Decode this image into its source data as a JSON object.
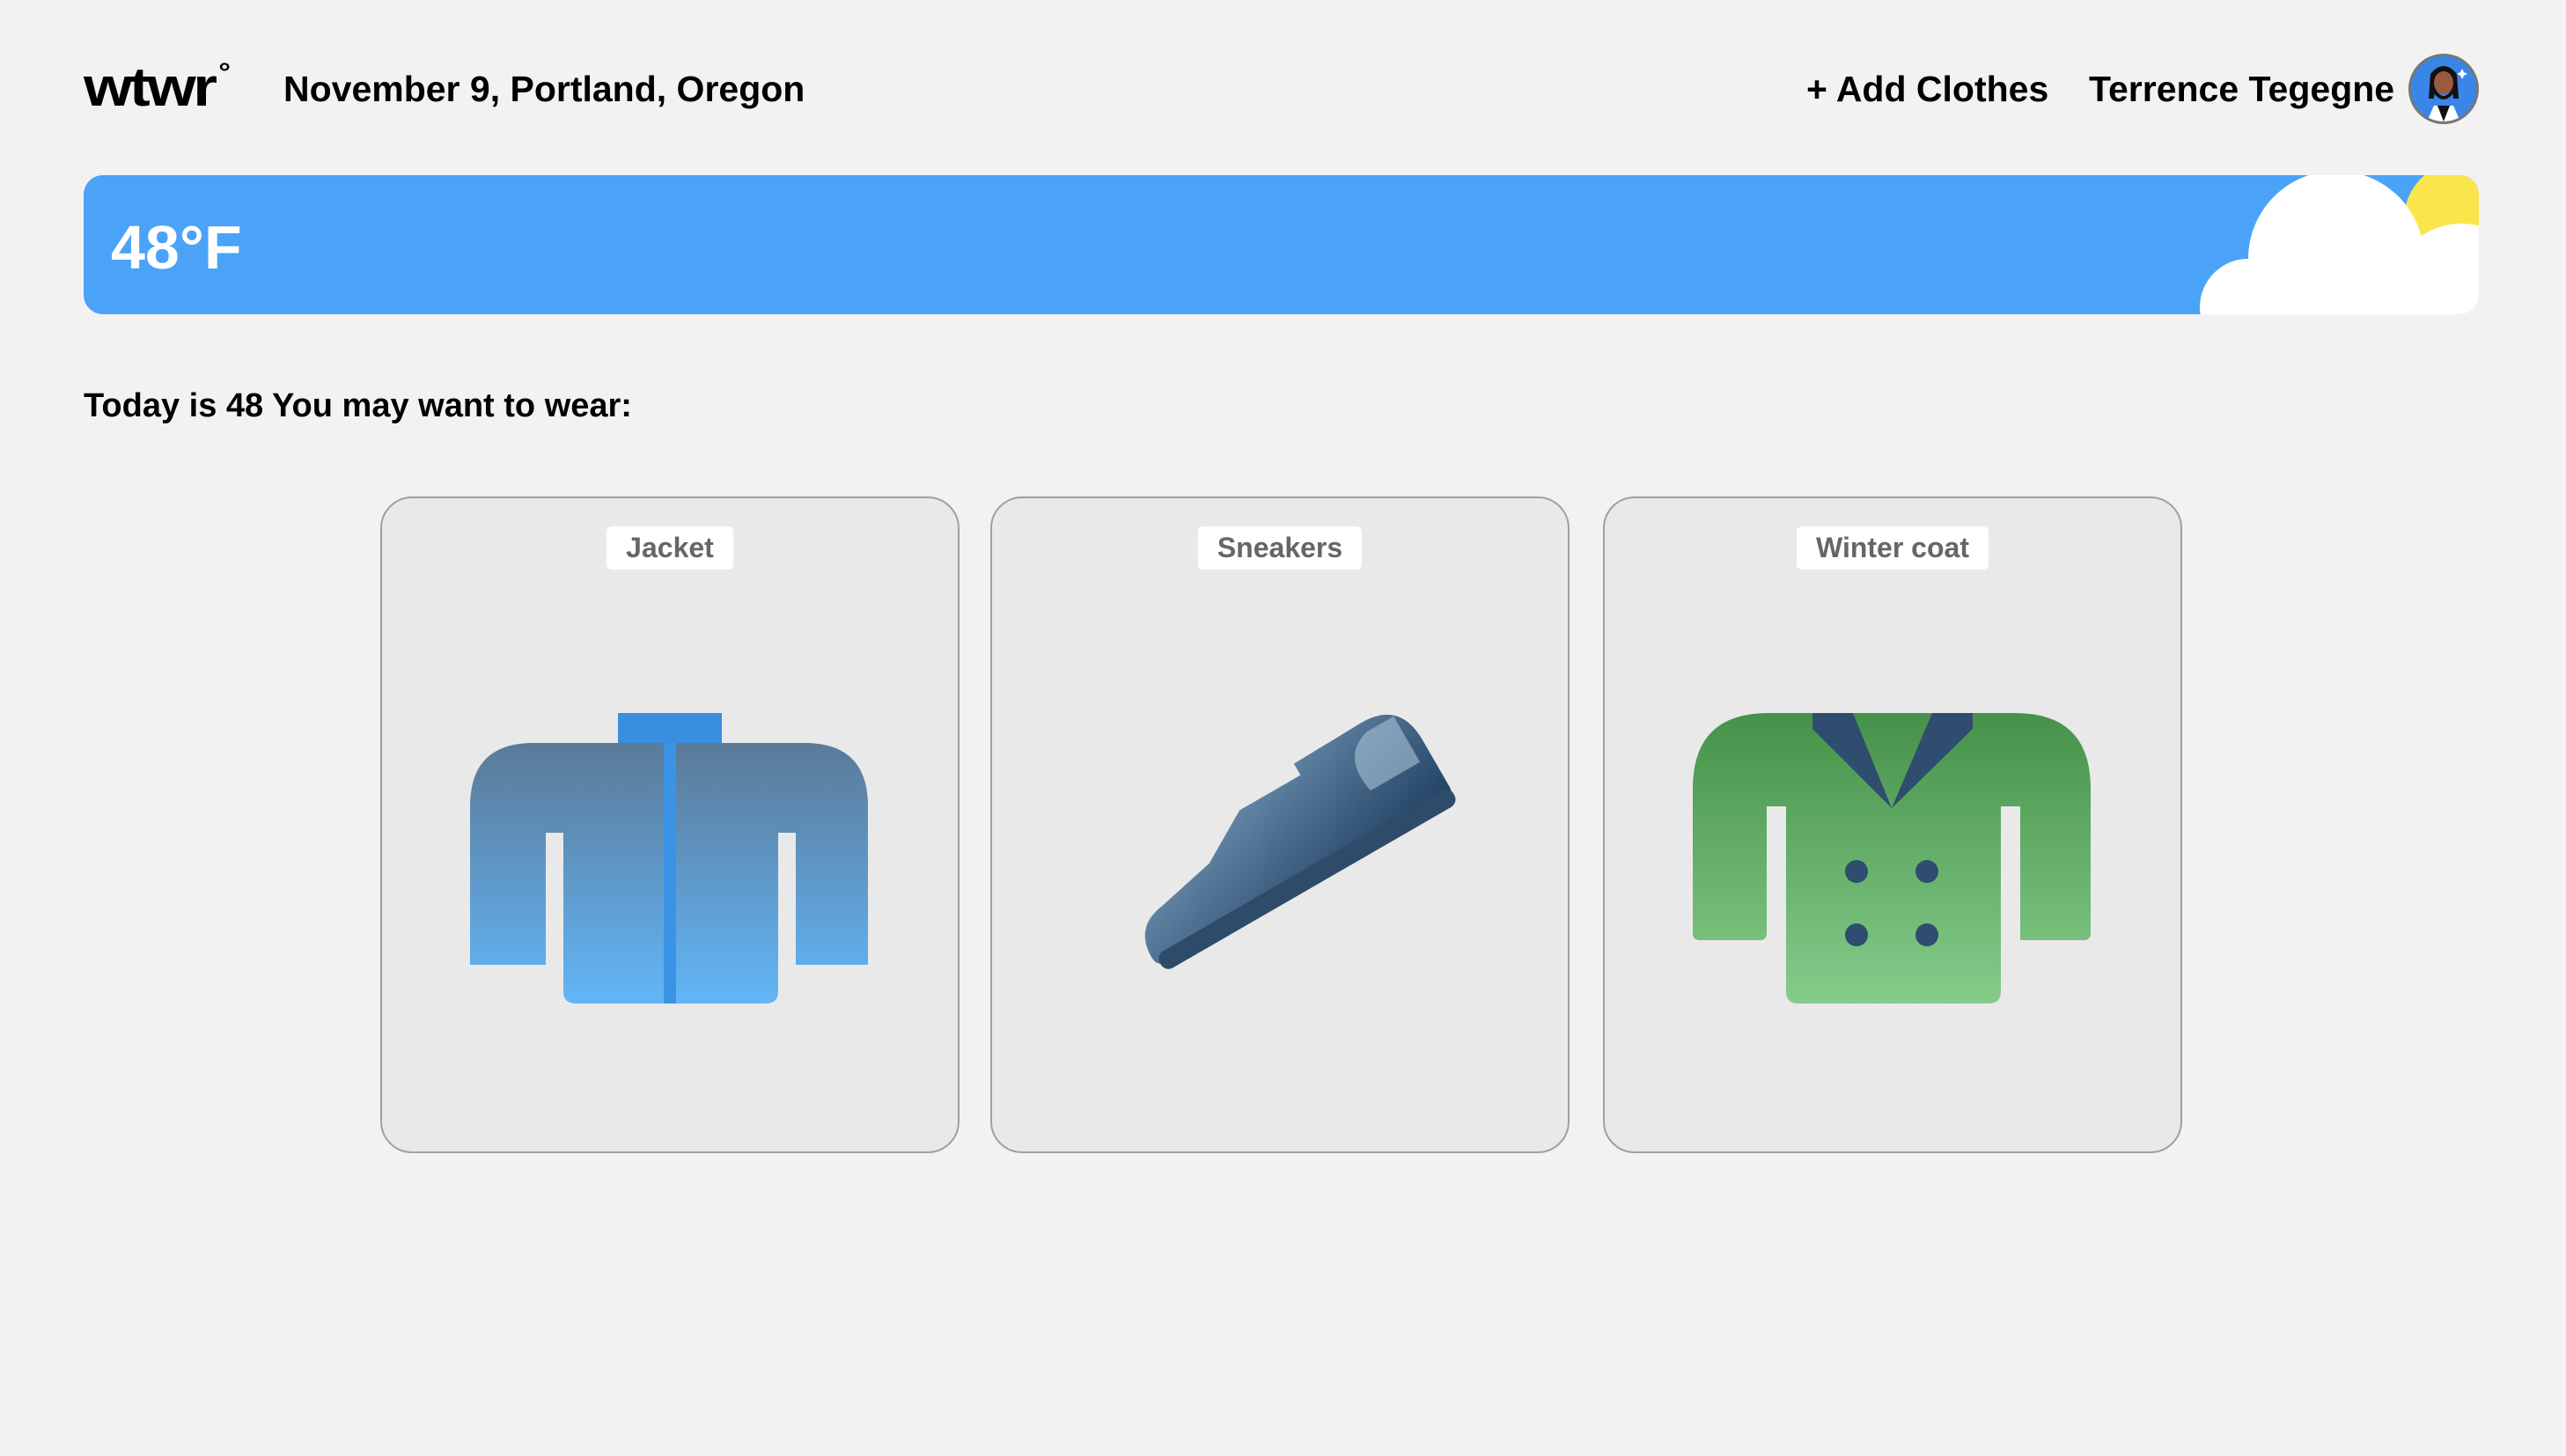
{
  "header": {
    "logo": "wtwr",
    "logo_mark": "°",
    "date_location": "November 9, Portland, Oregon",
    "add_clothes_label": "+ Add Clothes",
    "user_name": "Terrence Tegegne"
  },
  "weather": {
    "temperature": "48°F",
    "condition_icon": "sun-behind-cloud-icon",
    "colors": {
      "sky": "#4aa3f7",
      "sun": "#fbe54d",
      "cloud": "#ffffff"
    }
  },
  "recommendation": {
    "text": "Today is 48 You may want to wear:"
  },
  "items": [
    {
      "name": "Jacket",
      "icon": "jacket-icon"
    },
    {
      "name": "Sneakers",
      "icon": "sneaker-icon"
    },
    {
      "name": "Winter coat",
      "icon": "winter-coat-icon"
    }
  ]
}
